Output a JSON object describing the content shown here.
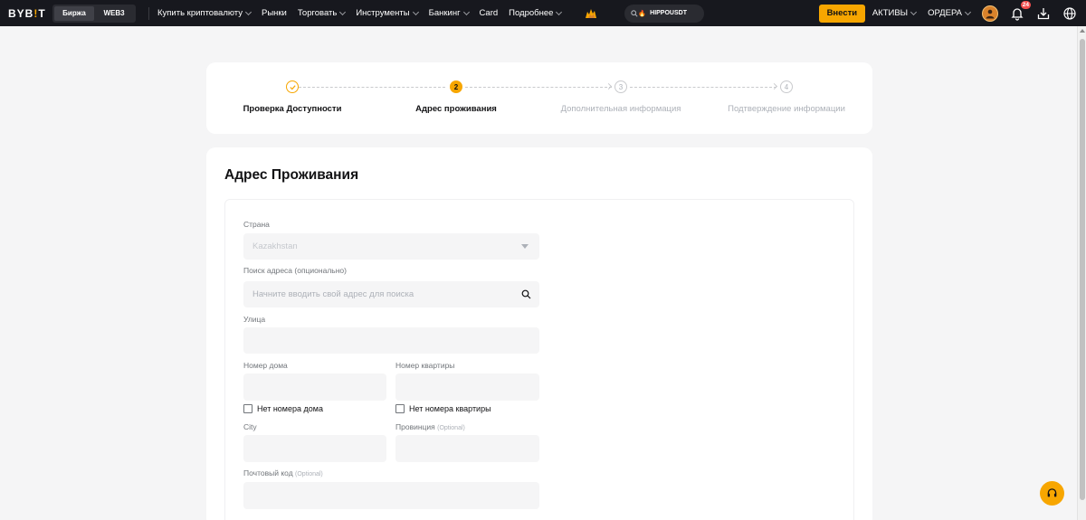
{
  "header": {
    "logo_main": "BYB",
    "logo_bang": "!",
    "logo_end": "T",
    "switch": [
      {
        "label": "Биржа"
      },
      {
        "label": "WEB3"
      }
    ],
    "nav": [
      {
        "label": "Купить криптовалюту",
        "dropdown": true
      },
      {
        "label": "Рынки",
        "dropdown": false
      },
      {
        "label": "Торговать",
        "dropdown": true
      },
      {
        "label": "Инструменты",
        "dropdown": true
      },
      {
        "label": "Банкинг",
        "dropdown": true
      },
      {
        "label": "Card",
        "dropdown": false
      },
      {
        "label": "Подробнее",
        "dropdown": true
      }
    ],
    "search_value": "HIPPOUSDT",
    "deposit_label": "Внести",
    "assets_label": "АКТИВЫ",
    "orders_label": "ОРДЕРА",
    "notification_count": "24",
    "accent": "#f7a600"
  },
  "stepper": {
    "steps": [
      {
        "num": "",
        "label": "Проверка Доступности",
        "state": "done"
      },
      {
        "num": "2",
        "label": "Адрес проживания",
        "state": "current"
      },
      {
        "num": "3",
        "label": "Дополнительная информация",
        "state": "future"
      },
      {
        "num": "4",
        "label": "Подтверждение информации",
        "state": "future"
      }
    ]
  },
  "form": {
    "title": "Адрес Проживания",
    "country_label": "Страна",
    "country_value": "Kazakhstan",
    "search_label": "Поиск адреса (опционально)",
    "search_placeholder": "Начните вводить свой адрес для поиска",
    "street_label": "Улица",
    "house_label": "Номер дома",
    "apartment_label": "Номер квартиры",
    "no_house_label": "Нет номера дома",
    "no_apartment_label": "Нет номера квартиры",
    "city_label": "City",
    "province_label": "Провинция",
    "province_optional": "(Optional)",
    "postal_label": "Почтовый код",
    "postal_optional": "(Optional)"
  }
}
